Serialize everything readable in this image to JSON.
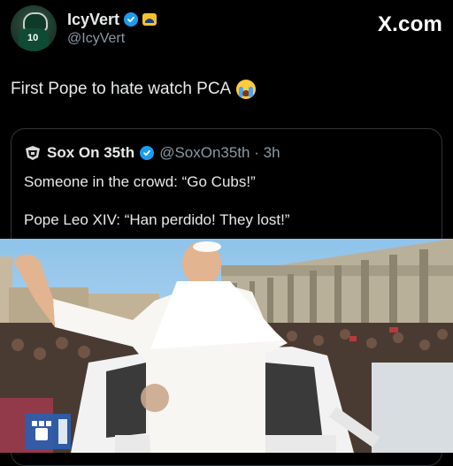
{
  "header": {
    "display_name": "IcyVert",
    "handle": "@IcyVert",
    "site_watermark": "X.com",
    "avatar_jersey_number": "10"
  },
  "tweet": {
    "text": "First Pope to hate watch PCA"
  },
  "quoted": {
    "name": "Sox On 35th",
    "handle_time": "@SoxOn35th · 3h",
    "line1": "Someone in the crowd: “Go Cubs!”",
    "line2": "Pope Leo XIV: “Han perdido! They lost!”"
  },
  "colors": {
    "background": "#000000",
    "verified": "#1d9bf0",
    "muted_text": "#8b98a5",
    "border": "#2f3336"
  },
  "icons": [
    "verified-badge-icon",
    "affiliate-badge-icon",
    "crying-emoji-icon",
    "sox-logo-icon",
    "vatican-media-logo"
  ]
}
